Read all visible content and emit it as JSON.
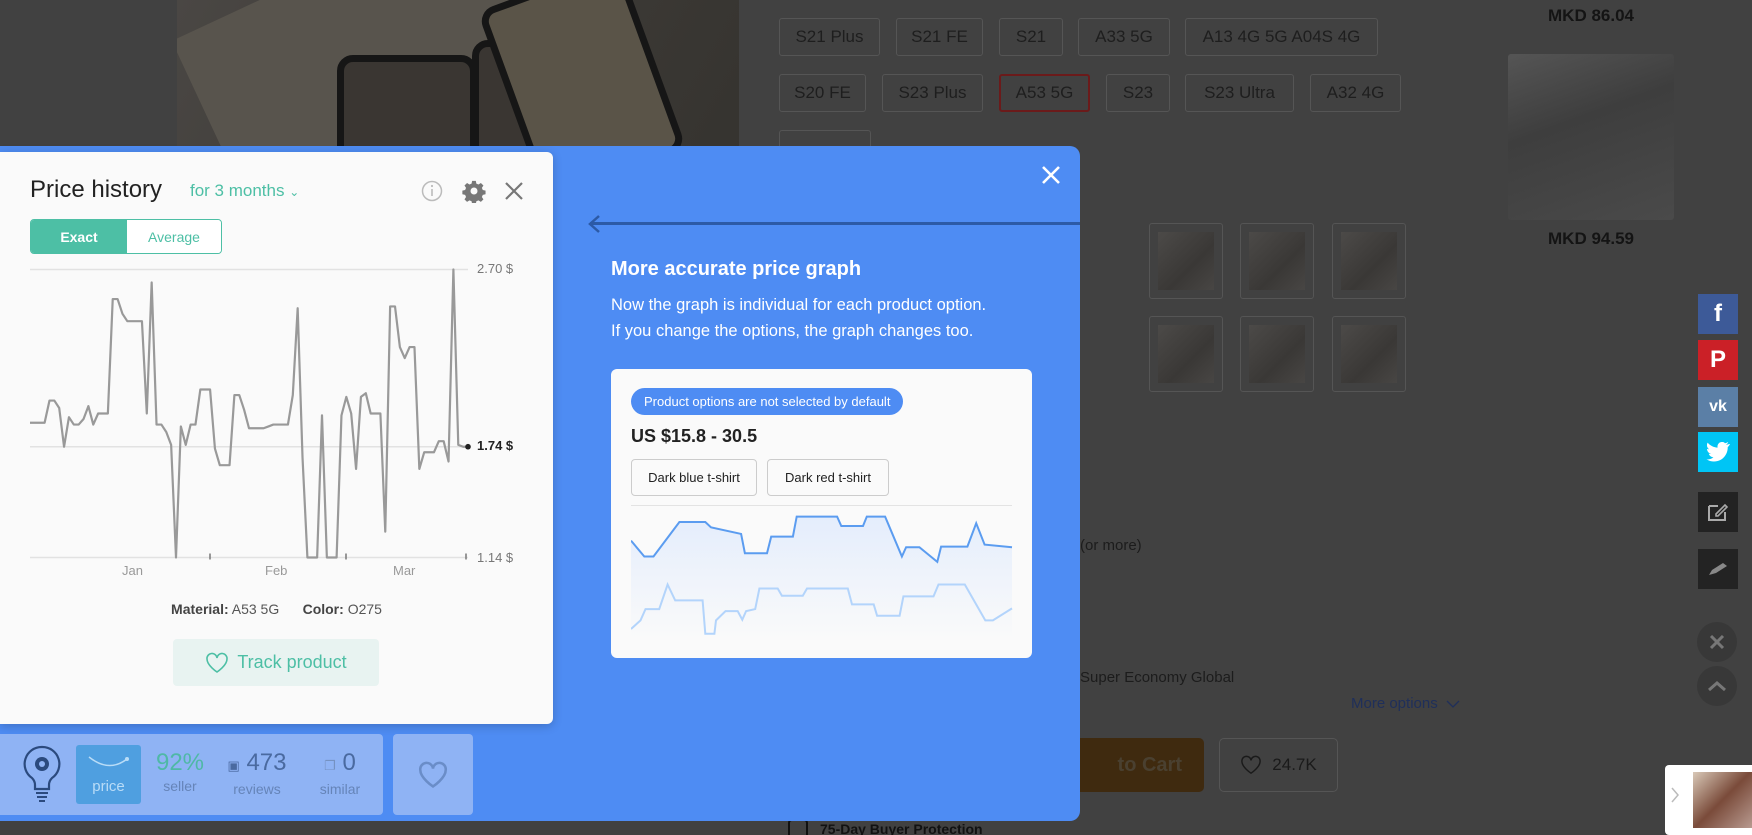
{
  "background": {
    "options_row1": [
      "S21 Plus",
      "S21 FE",
      "S21",
      "A33 5G",
      "A13 4G 5G A04S 4G"
    ],
    "options_row2": [
      "S20 FE",
      "S23 Plus",
      "A53 5G",
      "S23",
      "S23 Ultra",
      "A32 4G"
    ],
    "selected_option": "A53 5G",
    "related": [
      {
        "price": "MKD 86.04"
      },
      {
        "price": "MKD 94.59"
      }
    ],
    "quantity_note": "(or more)",
    "shipping": "Super Economy Global",
    "more_options": "More options",
    "add_to_cart": "to Cart",
    "wishlist_count": "24.7K",
    "protection": "75-Day Buyer Protection",
    "social": [
      "facebook",
      "pinterest",
      "vk",
      "twitter"
    ]
  },
  "tooltip": {
    "title": "More accurate price graph",
    "line1": "Now the graph is individual for each product option.",
    "line2": "If you change the options, the graph changes too.",
    "card": {
      "pill": "Product options are not selected by default",
      "price": "US $15.8 - 30.5",
      "buttons": [
        "Dark blue t-shirt",
        "Dark red t-shirt"
      ],
      "illustration_upper": [
        [
          0,
          74
        ],
        [
          3.5,
          62
        ],
        [
          5.9,
          62
        ],
        [
          12.7,
          88
        ],
        [
          19.5,
          88
        ],
        [
          21,
          84
        ],
        [
          28.9,
          79
        ],
        [
          29.9,
          64.5
        ],
        [
          35.7,
          64.5
        ],
        [
          36.8,
          77
        ],
        [
          42.5,
          77
        ],
        [
          43.5,
          92
        ],
        [
          54.1,
          92
        ],
        [
          55.2,
          85
        ],
        [
          60.9,
          85
        ],
        [
          61.9,
          92
        ],
        [
          66.7,
          92
        ],
        [
          71.1,
          62
        ],
        [
          72.2,
          69
        ],
        [
          75.7,
          69
        ],
        [
          80.4,
          58
        ],
        [
          81.4,
          69.5
        ],
        [
          88.3,
          69.5
        ],
        [
          90.6,
          87
        ],
        [
          92.8,
          71
        ],
        [
          100,
          69
        ]
      ],
      "illustration_lower": [
        [
          0,
          7.5
        ],
        [
          2.5,
          14
        ],
        [
          3.8,
          22.5
        ],
        [
          7.4,
          22.5
        ],
        [
          9.6,
          41
        ],
        [
          11.6,
          29
        ],
        [
          18.8,
          29
        ],
        [
          19.5,
          4
        ],
        [
          21.9,
          4
        ],
        [
          22.3,
          14
        ],
        [
          24.8,
          21
        ],
        [
          28,
          21
        ],
        [
          29.2,
          14.5
        ],
        [
          30.2,
          21
        ],
        [
          32.6,
          22.5
        ],
        [
          33.7,
          38
        ],
        [
          38.5,
          38
        ],
        [
          39.6,
          32.5
        ],
        [
          45.1,
          32.5
        ],
        [
          46.2,
          38
        ],
        [
          56.9,
          38
        ],
        [
          58,
          26
        ],
        [
          63.7,
          26
        ],
        [
          64.6,
          17.5
        ],
        [
          70.5,
          17.5
        ],
        [
          71.5,
          32
        ],
        [
          79.4,
          32
        ],
        [
          80.7,
          41
        ],
        [
          87.6,
          41
        ],
        [
          93,
          14
        ],
        [
          95,
          14
        ],
        [
          100,
          23
        ]
      ],
      "colors": {
        "upper": "#5b9cf0",
        "lower": "#b3d4fb"
      }
    }
  },
  "price_history": {
    "title": "Price history",
    "range": "for 3 months",
    "toggle": [
      "Exact",
      "Average"
    ],
    "active_toggle": "Exact",
    "material_label": "Material:",
    "material_value": "A53 5G",
    "color_label": "Color:",
    "color_value": "O275",
    "track_label": "Track product",
    "accent": "#4dbfa5"
  },
  "chart_data": {
    "type": "line",
    "x_range": [
      "Dec 26",
      "Mar 26"
    ],
    "x_interval": "daily",
    "x_tick_labels": [
      "Jan",
      "Feb",
      "Mar"
    ],
    "y_tick_labels": [
      "2.70 $",
      "1.74 $",
      "1.14 $"
    ],
    "ylim": [
      1.14,
      2.7
    ],
    "current": 1.74,
    "grid": true,
    "values": [
      1.87,
      1.87,
      1.87,
      1.87,
      1.99,
      1.99,
      1.95,
      1.74,
      1.9,
      1.86,
      1.86,
      1.89,
      1.96,
      1.86,
      1.92,
      1.92,
      1.92,
      2.54,
      2.54,
      2.46,
      2.42,
      2.42,
      2.42,
      2.42,
      1.92,
      2.63,
      1.86,
      1.86,
      1.82,
      1.75,
      1.14,
      1.85,
      1.75,
      1.86,
      1.86,
      2.05,
      2.05,
      2.05,
      1.73,
      1.64,
      1.64,
      1.64,
      2.02,
      2.02,
      1.94,
      1.84,
      1.84,
      1.84,
      1.84,
      1.85,
      1.86,
      1.86,
      1.86,
      1.86,
      2.02,
      2.49,
      1.68,
      1.14,
      1.14,
      1.14,
      1.91,
      1.14,
      1.14,
      1.14,
      1.91,
      2.01,
      1.92,
      1.62,
      2.01,
      2.03,
      1.92,
      1.92,
      1.92,
      1.28,
      2.5,
      2.5,
      2.28,
      2.22,
      2.28,
      2.28,
      1.62,
      1.71,
      1.71,
      1.71,
      1.77,
      1.77,
      1.66,
      2.7,
      1.75,
      1.74,
      1.74
    ],
    "line_color": "#999999"
  },
  "toolbar": {
    "price_label": "price",
    "seller_value": "92%",
    "seller_label": "seller",
    "reviews_value": "473",
    "reviews_label": "reviews",
    "similar_value": "0",
    "similar_label": "similar"
  }
}
